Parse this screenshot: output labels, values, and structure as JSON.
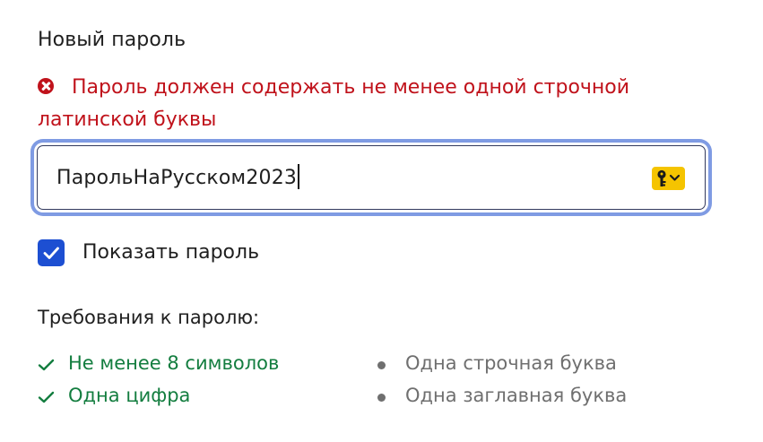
{
  "password_field": {
    "label": "Новый пароль",
    "error": "Пароль должен содержать не менее одной строчной латинской буквы",
    "value": "ПарольНаРусском2023",
    "error_icon": "error-x-circle-icon",
    "manager_icon": "password-manager-key-icon"
  },
  "show_password": {
    "label": "Показать пароль",
    "checked": true
  },
  "requirements": {
    "title": "Требования к паролю:",
    "items": [
      {
        "text": "Не менее 8 символов",
        "met": true
      },
      {
        "text": "Одна цифра",
        "met": true
      },
      {
        "text": "Одна строчная буква",
        "met": false
      },
      {
        "text": "Одна заглавная буква",
        "met": false
      }
    ]
  },
  "colors": {
    "error": "#c0121b",
    "success": "#137d3f",
    "muted": "#6f6f6f",
    "focus_ring": "#7f9be3",
    "checkbox": "#1d4fd2",
    "password_manager": "#f5c400"
  }
}
